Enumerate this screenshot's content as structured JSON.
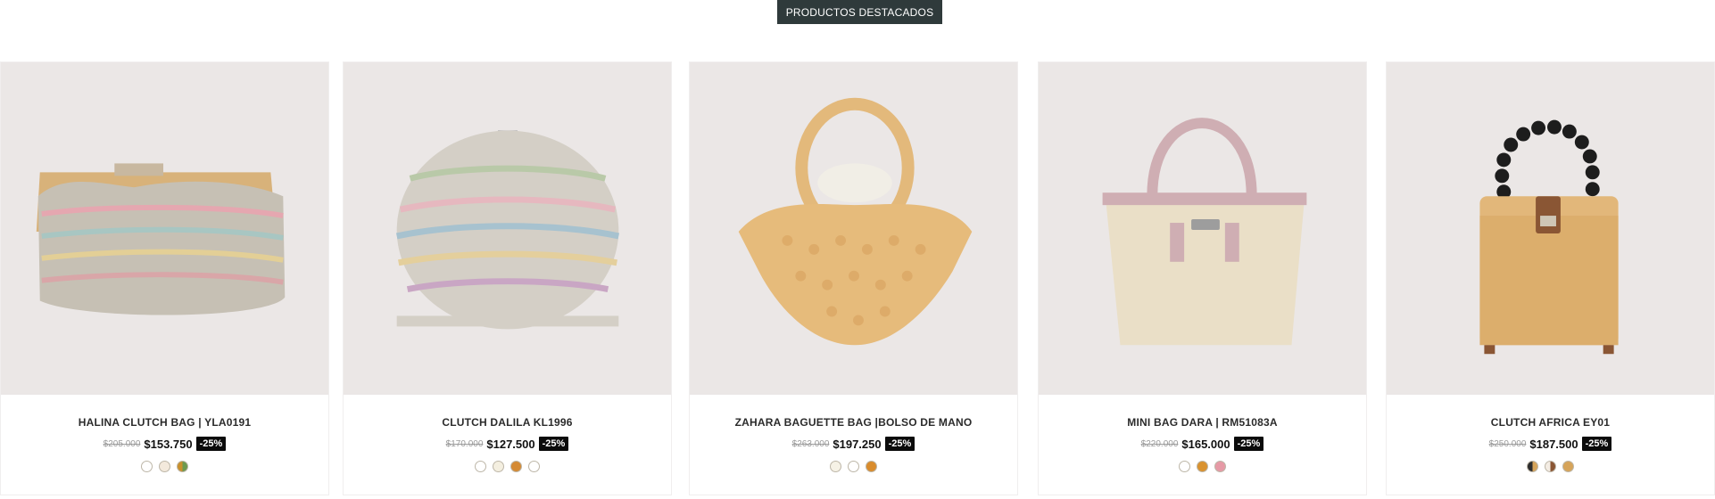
{
  "header": {
    "label": "PRODUCTOS DESTACADOS"
  },
  "products": [
    {
      "title": "HALINA CLUTCH BAG | YLA0191",
      "old_price": "$205.000",
      "price": "$153.750",
      "discount": "-25%",
      "swatches": [
        "#ffffff",
        "#f3e9dc",
        "#c9902c"
      ],
      "image": "straw-clutch-icon"
    },
    {
      "title": "CLUTCH DALILA KL1996",
      "old_price": "$170.000",
      "price": "$127.500",
      "discount": "-25%",
      "swatches": [
        "#ffffff",
        "#f4efe0",
        "#d48a34",
        "#ffffff"
      ],
      "image": "round-woven-bag-icon"
    },
    {
      "title": "ZAHARA BAGUETTE BAG |BOLSO DE MANO",
      "old_price": "$263.000",
      "price": "$197.250",
      "discount": "-25%",
      "swatches": [
        "#f6f2e6",
        "#ffffff",
        "#d98c2d"
      ],
      "image": "beaded-bag-icon"
    },
    {
      "title": "MINI BAG DARA | RM51083A",
      "old_price": "$220.000",
      "price": "$165.000",
      "discount": "-25%",
      "swatches": [
        "#ffffff",
        "#d9922f",
        "#e69aa6"
      ],
      "image": "straw-tote-icon"
    },
    {
      "title": "CLUTCH AFRICA EY01",
      "old_price": "$250.000",
      "price": "$187.500",
      "discount": "-25%",
      "swatches": [
        "#2d2d2d",
        "#f4ede4",
        "#d6a45a"
      ],
      "image": "rattan-basket-bag-icon"
    }
  ]
}
